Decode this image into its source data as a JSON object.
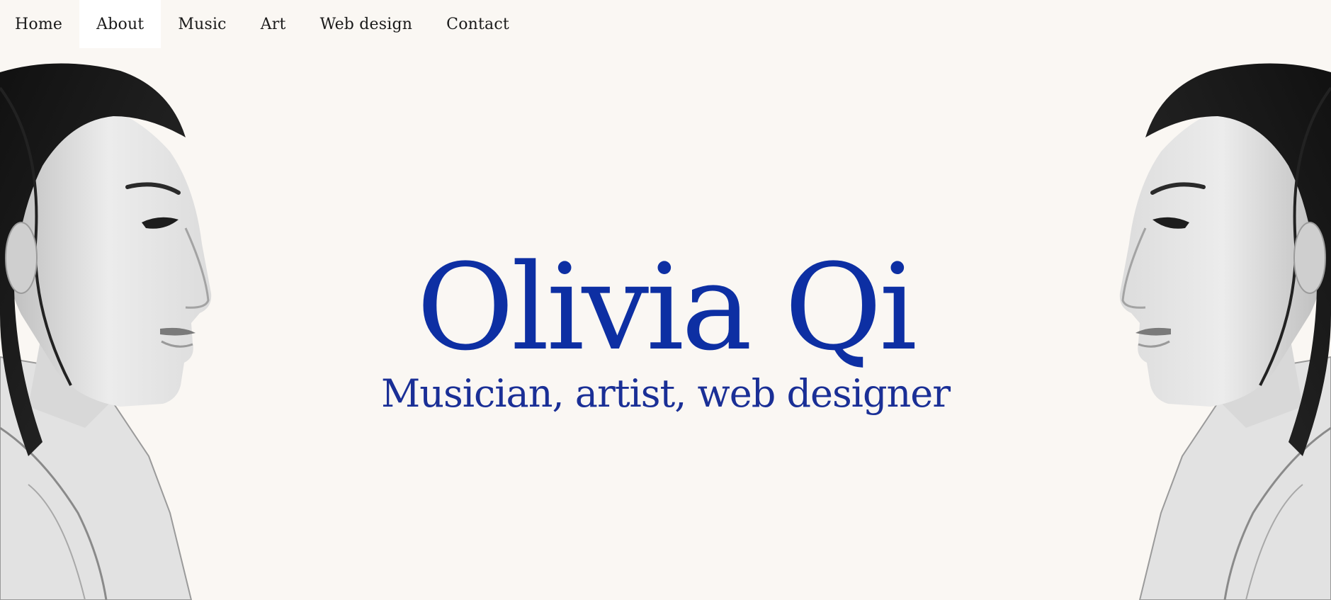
{
  "nav": {
    "items": [
      {
        "label": "Home",
        "active": false
      },
      {
        "label": "About",
        "active": true
      },
      {
        "label": "Music",
        "active": false
      },
      {
        "label": "Art",
        "active": false
      },
      {
        "label": "Web design",
        "active": false
      },
      {
        "label": "Contact",
        "active": false
      }
    ]
  },
  "hero": {
    "name": "Olivia Qi",
    "tagline": "Musician, artist, web designer"
  },
  "portraits": {
    "left": {
      "icon": "portrait-profile-right-facing"
    },
    "right": {
      "icon": "portrait-profile-left-facing"
    }
  },
  "colors": {
    "background": "#faf7f3",
    "accent": "#0d2fa3",
    "tagline": "#1a2f96",
    "nav_active_bg": "#ffffff",
    "nav_text": "#1a1a1a"
  }
}
